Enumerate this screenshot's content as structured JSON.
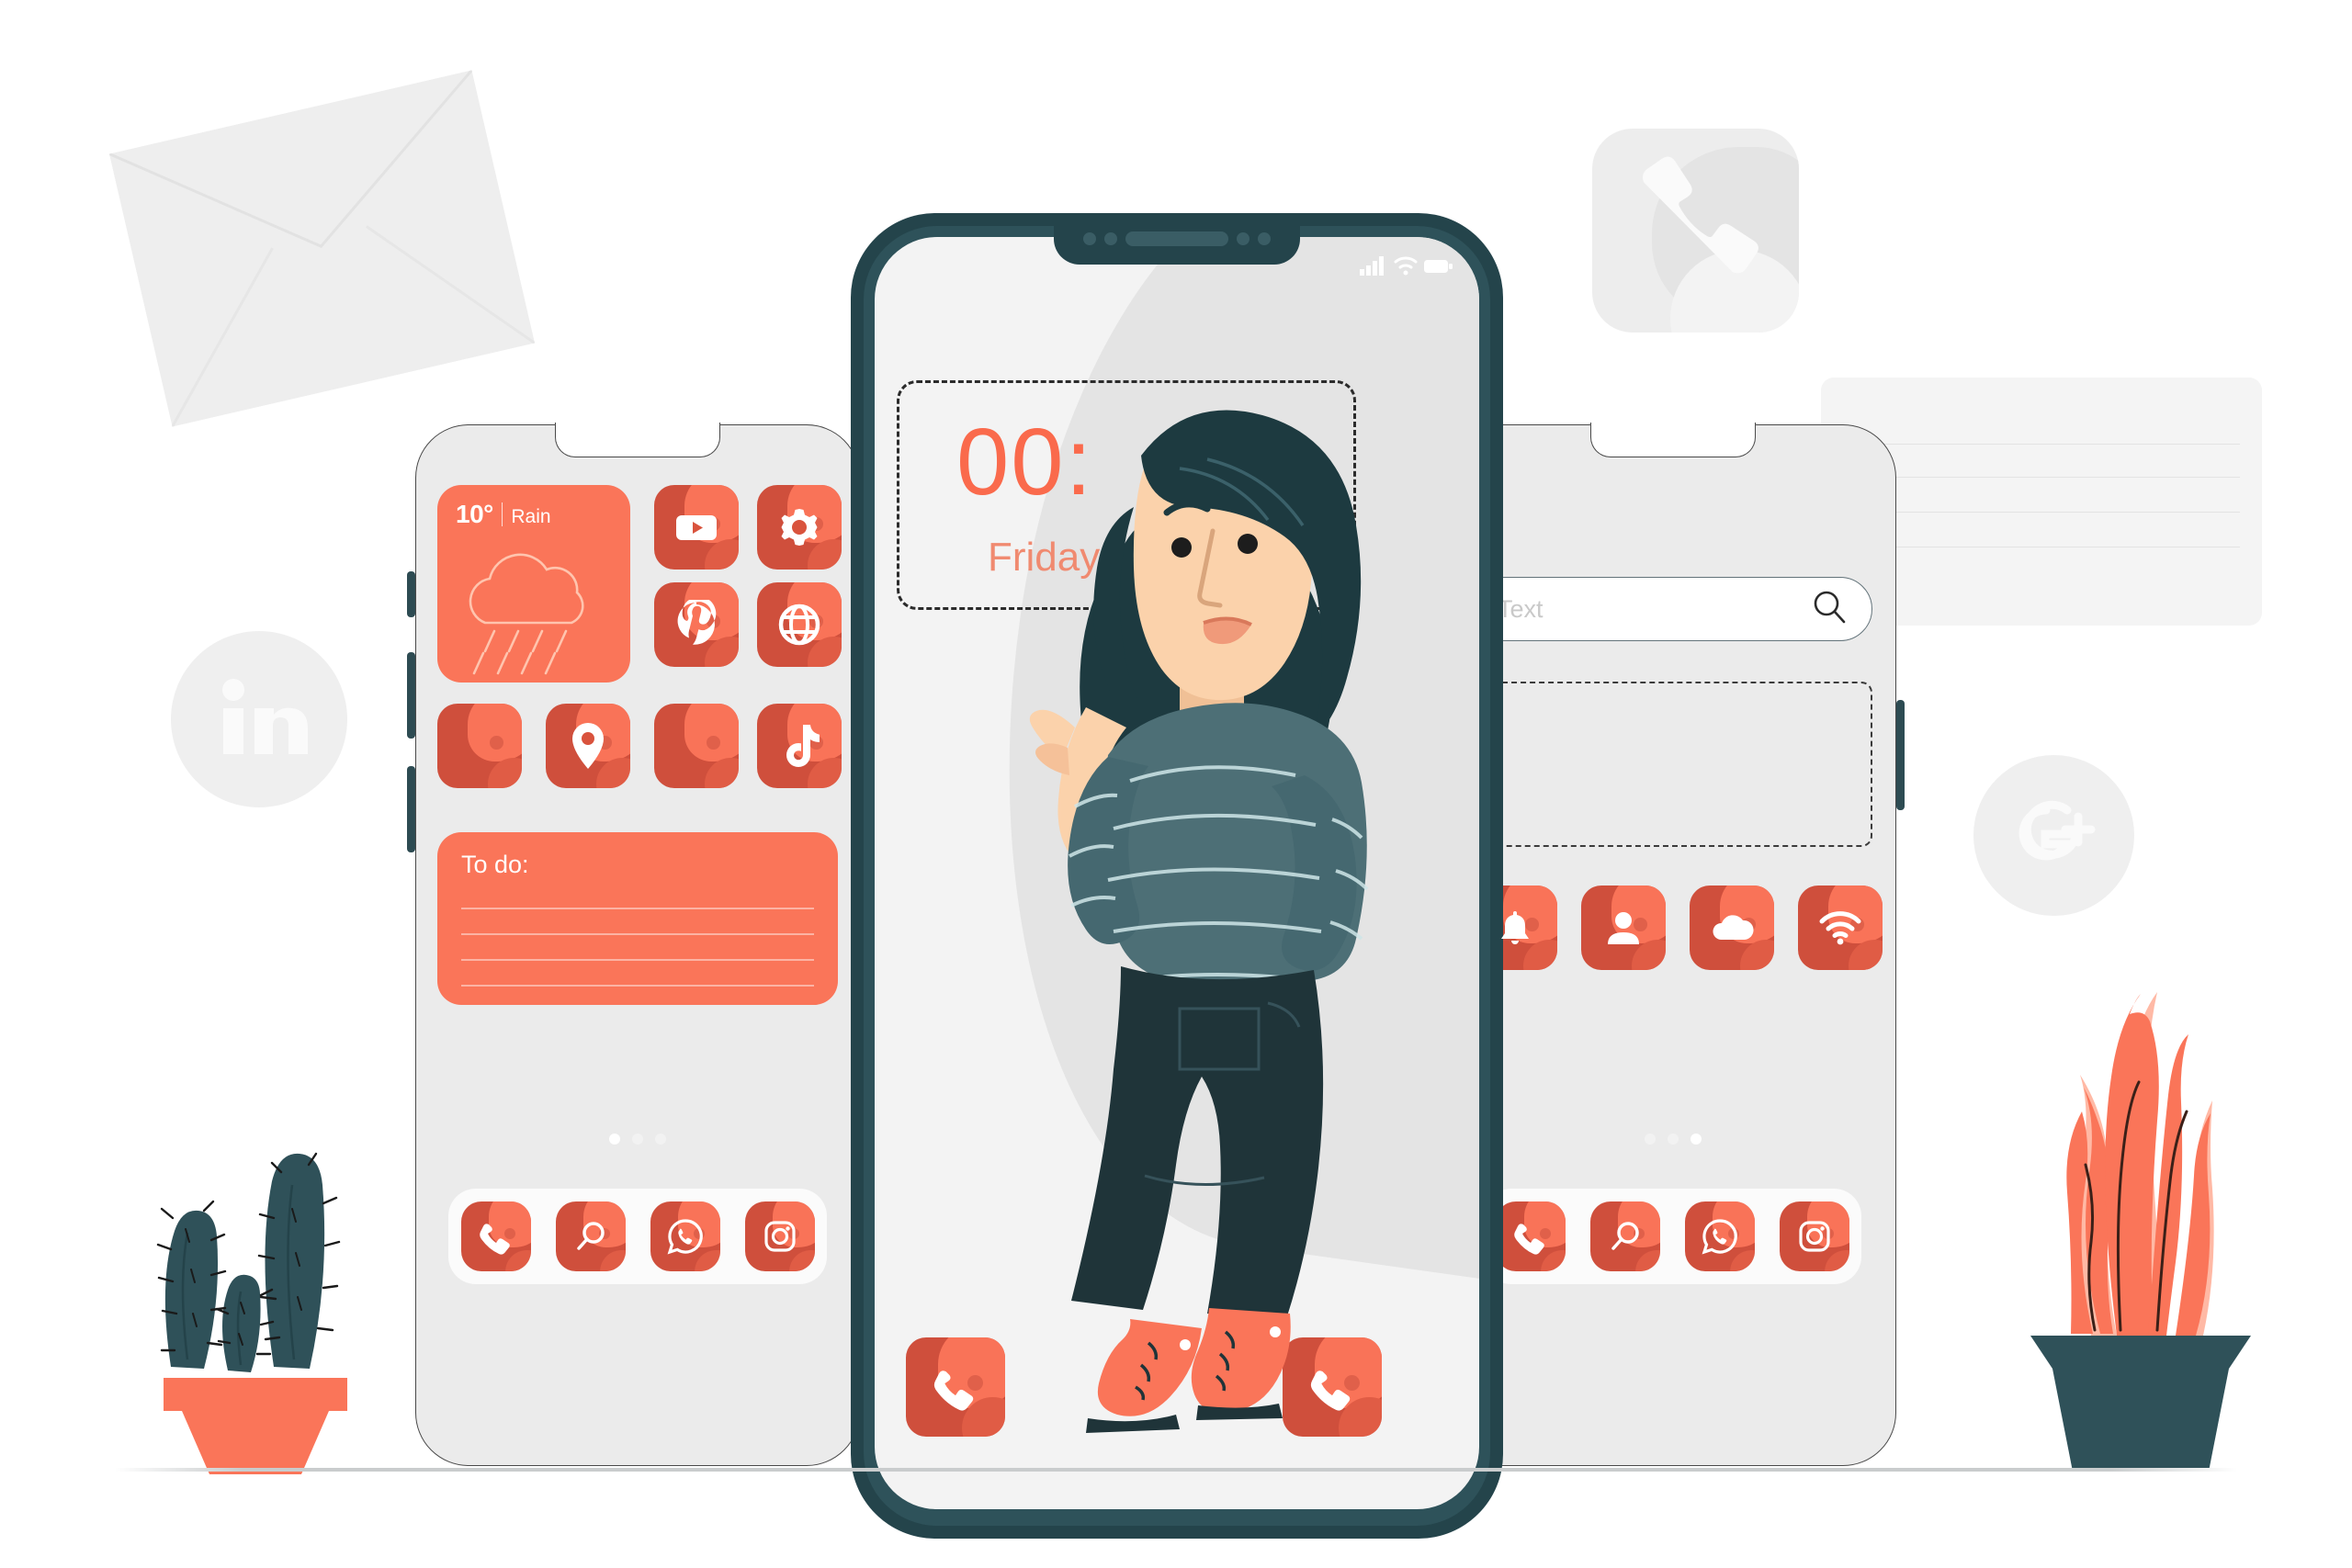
{
  "illustration": {
    "title": "Mobile apps concept illustration",
    "palette": {
      "coral": "#fa7559",
      "coral_dark": "#cf4f3c",
      "teal_dark": "#24444b",
      "teal_sweater": "#4d6f76",
      "navy_jeans": "#1f3439",
      "skin": "#fbd2ab",
      "hair": "#1d3a40",
      "screen_gray": "#f3f3f3",
      "bg_gray": "#ebebeb",
      "white": "#ffffff"
    }
  },
  "phone_left": {
    "weather_widget": {
      "temperature": "10°",
      "condition": "Rain",
      "icon": "rain-cloud-icon"
    },
    "app_icons": [
      {
        "name": "youtube-icon",
        "label": "YouTube"
      },
      {
        "name": "settings-gear-icon",
        "label": "Settings"
      },
      {
        "name": "pinterest-icon",
        "label": "Pinterest"
      },
      {
        "name": "globe-browser-icon",
        "label": "Browser"
      },
      {
        "name": "blank-app-icon",
        "label": ""
      },
      {
        "name": "map-pin-icon",
        "label": "Maps"
      },
      {
        "name": "blank-app-icon-2",
        "label": ""
      },
      {
        "name": "tiktok-icon",
        "label": "TikTok"
      }
    ],
    "todo_widget": {
      "title": "To do:",
      "line_count": 4
    },
    "page_dots": {
      "count": 3,
      "active_index": 0
    },
    "dock_icons": [
      {
        "name": "phone-icon",
        "label": "Phone"
      },
      {
        "name": "search-icon",
        "label": "Search"
      },
      {
        "name": "whatsapp-icon",
        "label": "WhatsApp"
      },
      {
        "name": "instagram-icon",
        "label": "Instagram"
      }
    ]
  },
  "phone_center": {
    "status_icons": [
      "signal-bars-icon",
      "wifi-icon",
      "battery-icon"
    ],
    "clock_widget": {
      "time": "00:",
      "day": "Friday",
      "border_style": "dashed"
    },
    "bottom_app_icons": [
      {
        "name": "phone-icon-left",
        "label": "Phone"
      },
      {
        "name": "phone-icon-right",
        "label": "Phone"
      }
    ]
  },
  "phone_right": {
    "search": {
      "placeholder": "Text",
      "value": "",
      "icon": "search-icon"
    },
    "content_placeholder": {
      "style": "dashed-box"
    },
    "app_icons": [
      {
        "name": "bell-notification-icon",
        "label": "Notifications"
      },
      {
        "name": "contact-person-icon",
        "label": "Contacts"
      },
      {
        "name": "cloud-icon",
        "label": "Cloud"
      },
      {
        "name": "wifi-icon",
        "label": "Wi-Fi"
      }
    ],
    "page_dots": {
      "count": 3,
      "active_index": 2
    },
    "dock_icons": [
      {
        "name": "phone-icon",
        "label": "Phone"
      },
      {
        "name": "search-icon",
        "label": "Search"
      },
      {
        "name": "whatsapp-icon",
        "label": "WhatsApp"
      },
      {
        "name": "instagram-icon",
        "label": "Instagram"
      }
    ]
  },
  "background": {
    "envelope": {
      "name": "envelope-icon",
      "label": "Mail envelope"
    },
    "app_icon_phone": {
      "name": "phone-app-icon",
      "label": "Phone app"
    },
    "document_card": {
      "name": "note-card",
      "label": "Lined note card",
      "line_count": 4
    },
    "social": [
      {
        "name": "linkedin-icon",
        "label": "in"
      },
      {
        "name": "google-plus-icon",
        "label": "G+"
      }
    ]
  },
  "decor": {
    "cactus": {
      "name": "cactus-plant",
      "label": "Cactus in pot",
      "stem_count": 3
    },
    "snake_plant": {
      "name": "snake-plant",
      "label": "Snake plant in pot",
      "leaf_count": 4
    }
  },
  "character": {
    "name": "woman-pointing",
    "label": "Woman leaning and pointing at the phone screen",
    "outfit": {
      "top": "striped teal sweater",
      "bottom": "navy jeans",
      "shoes": "coral sneakers"
    }
  }
}
